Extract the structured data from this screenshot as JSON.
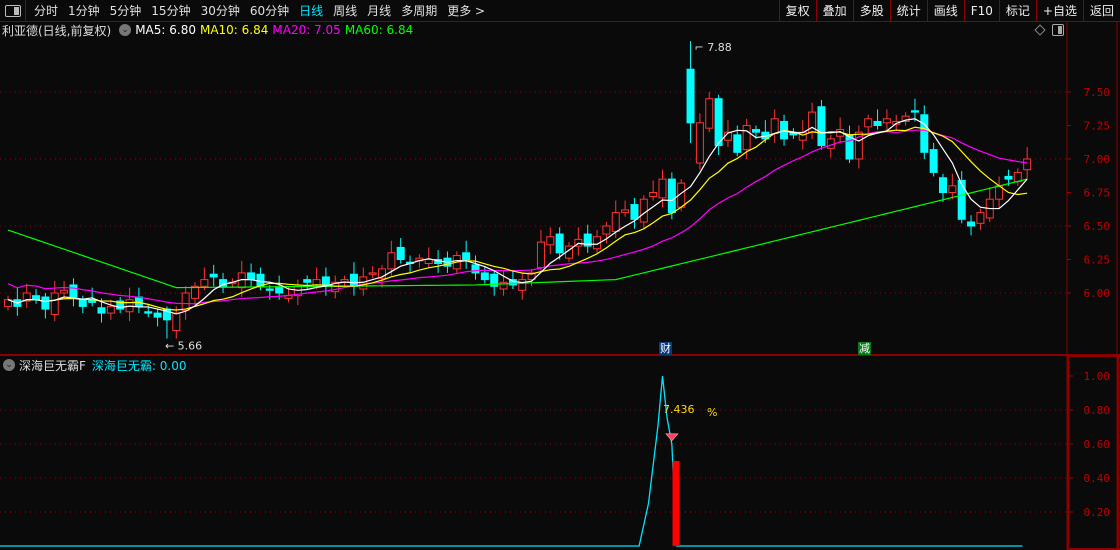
{
  "toolbar": {
    "periods": [
      "分时",
      "1分钟",
      "5分钟",
      "15分钟",
      "30分钟",
      "60分钟",
      "日线",
      "周线",
      "月线",
      "多周期",
      "更多 >"
    ],
    "active_period": "日线",
    "buttons": [
      "复权",
      "叠加",
      "多股",
      "统计",
      "画线",
      "F10",
      "标记",
      "+自选",
      "返回"
    ]
  },
  "header": {
    "title": "利亚德(日线,前复权)",
    "ma5": "MA5: 6.80",
    "ma10": "MA10: 6.84",
    "ma20": "MA20: 7.05",
    "ma60": "MA60: 6.84",
    "colors": {
      "ma5": "#ffffff",
      "ma10": "#ffff00",
      "ma20": "#ff00ff",
      "ma60": "#00ff00",
      "up": "#ff3333",
      "down": "#00ffff"
    }
  },
  "sub_header": {
    "title": "深海巨无霸F",
    "value_label": "深海巨无霸: 0.00"
  },
  "markers": {
    "cai": "财",
    "jian": "减"
  },
  "chart_data": [
    {
      "type": "candlestick",
      "title": "利亚德 日线",
      "ylim": [
        5.55,
        7.95
      ],
      "yticks": [
        "7.50",
        "7.25",
        "7.00",
        "6.75",
        "6.50",
        "6.25",
        "6.00"
      ],
      "high_label": "7.88",
      "low_label": "5.66",
      "closes": [
        5.95,
        5.9,
        6.0,
        5.95,
        5.88,
        6.0,
        6.02,
        5.97,
        5.9,
        5.93,
        5.85,
        5.9,
        5.88,
        5.95,
        5.9,
        5.85,
        5.82,
        5.8,
        5.85,
        6.0,
        6.05,
        6.1,
        6.12,
        6.05,
        6.08,
        6.15,
        6.1,
        6.05,
        6.02,
        6.0,
        5.98,
        6.05,
        6.08,
        6.1,
        6.05,
        6.08,
        6.1,
        6.05,
        6.12,
        6.15,
        6.18,
        6.3,
        6.25,
        6.22,
        6.26,
        6.25,
        6.22,
        6.2,
        6.28,
        6.25,
        6.15,
        6.1,
        6.05,
        6.08,
        6.06,
        6.1,
        6.15,
        6.38,
        6.42,
        6.3,
        6.35,
        6.4,
        6.35,
        6.42,
        6.5,
        6.6,
        6.62,
        6.55,
        6.7,
        6.75,
        6.85,
        6.6,
        6.82,
        6.95,
        7.27,
        7.45,
        7.1,
        7.2,
        7.05,
        7.25,
        7.2,
        7.15,
        7.3,
        7.15,
        7.18,
        7.2,
        7.35,
        7.1,
        7.15,
        7.22,
        7.0,
        7.2,
        7.3,
        7.25,
        7.3,
        7.28,
        7.32,
        7.35,
        7.05,
        6.9,
        6.75,
        6.8,
        6.55,
        6.5,
        6.6,
        6.7,
        6.8,
        6.85,
        6.9,
        7.0
      ],
      "ma60_anchors": [
        [
          0,
          6.47
        ],
        [
          18,
          6.04
        ],
        [
          50,
          6.06
        ],
        [
          65,
          6.1
        ],
        [
          78,
          6.32
        ],
        [
          102,
          6.73
        ],
        [
          109,
          6.85
        ]
      ]
    },
    {
      "type": "line+bar",
      "title": "深海巨无霸F",
      "ylim": [
        0,
        1.1
      ],
      "yticks": [
        "1.00",
        "0.80",
        "0.60",
        "0.40",
        "0.20"
      ],
      "line_points": [
        [
          68,
          0
        ],
        [
          69,
          0.25
        ],
        [
          70,
          0.7
        ],
        [
          70.5,
          1.0
        ],
        [
          71,
          0.75
        ],
        [
          71.5,
          0.6
        ],
        [
          72,
          0
        ],
        [
          109,
          0
        ]
      ],
      "bar": {
        "index": 71.5,
        "value": 0.5
      },
      "annotation": "7.436",
      "annotation_unit": "%"
    }
  ]
}
